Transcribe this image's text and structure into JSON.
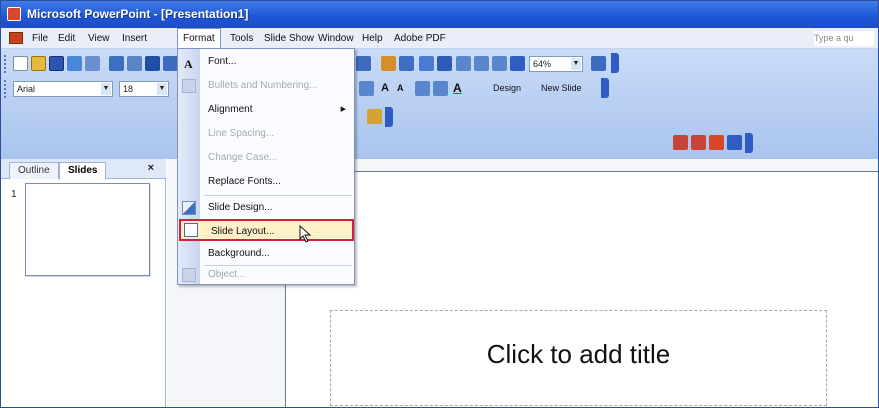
{
  "window": {
    "title": "Microsoft PowerPoint - [Presentation1]"
  },
  "menubar": {
    "items": [
      "File",
      "Edit",
      "View",
      "Insert",
      "Format",
      "Tools",
      "Slide Show",
      "Window",
      "Help",
      "Adobe PDF"
    ],
    "active": "Format",
    "help_placeholder": "Type a qu"
  },
  "toolbar": {
    "font_name": "Arial",
    "font_size": "18",
    "zoom": "64%",
    "design_label": "Design",
    "new_slide_label": "New Slide"
  },
  "left_pane": {
    "tabs": [
      "Outline",
      "Slides"
    ],
    "selected_tab": "Slides",
    "close_glyph": "×",
    "slide_number": "1"
  },
  "slide": {
    "title_placeholder": "Click to add title"
  },
  "format_menu": {
    "items": [
      {
        "label": "Font...",
        "disabled": false,
        "icon": "font-a-icon"
      },
      {
        "label": "Bullets and Numbering...",
        "disabled": true,
        "icon": "bullets-icon"
      },
      {
        "label": "Alignment",
        "disabled": false,
        "submenu": true
      },
      {
        "label": "Line Spacing...",
        "disabled": true
      },
      {
        "label": "Change Case...",
        "disabled": true
      },
      {
        "label": "Replace Fonts...",
        "disabled": false
      },
      {
        "label": "Slide Design...",
        "disabled": false,
        "icon": "slide-design-icon"
      },
      {
        "label": "Slide Layout...",
        "disabled": false,
        "highlighted": true,
        "icon": "slide-layout-icon"
      },
      {
        "label": "Background...",
        "disabled": false
      },
      {
        "label": "Object...",
        "disabled": true,
        "icon": "object-icon"
      }
    ]
  },
  "colors": {
    "title_bar": "#1d55d6",
    "highlight_border": "#d0223a",
    "highlight_fill": "#fff1c8"
  }
}
